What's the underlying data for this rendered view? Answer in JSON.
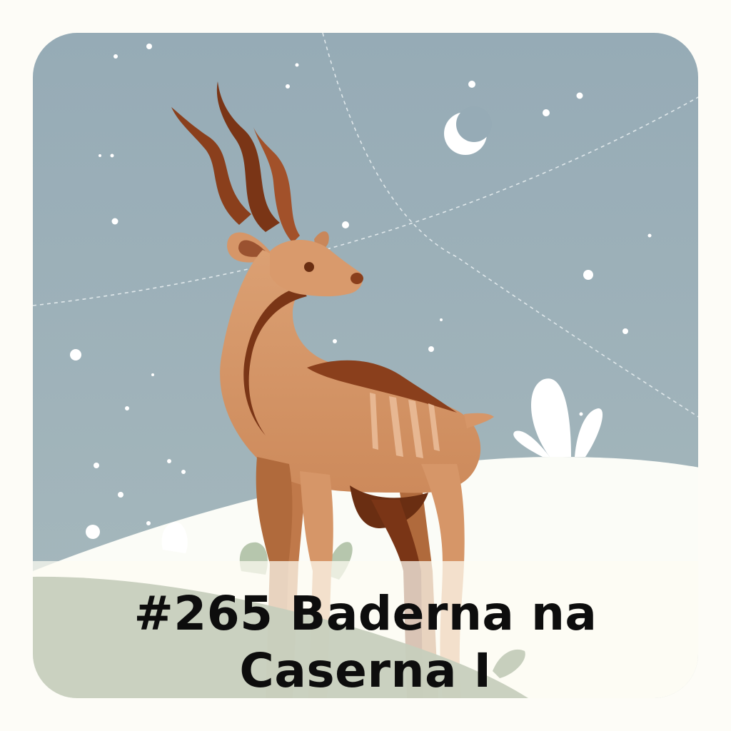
{
  "episode": {
    "title_line1": "#265 Baderna na",
    "title_line2": "Caserna I"
  },
  "icons": {
    "animal": "kudu-antelope-illustration",
    "moon": "crescent-moon-icon"
  },
  "colors": {
    "sky": "#9aafb9",
    "hill": "#fbfcf7",
    "body": "#d69668",
    "dark": "#8a3f1c",
    "banner": "#fdfcf3",
    "text": "#0d0d0d"
  }
}
